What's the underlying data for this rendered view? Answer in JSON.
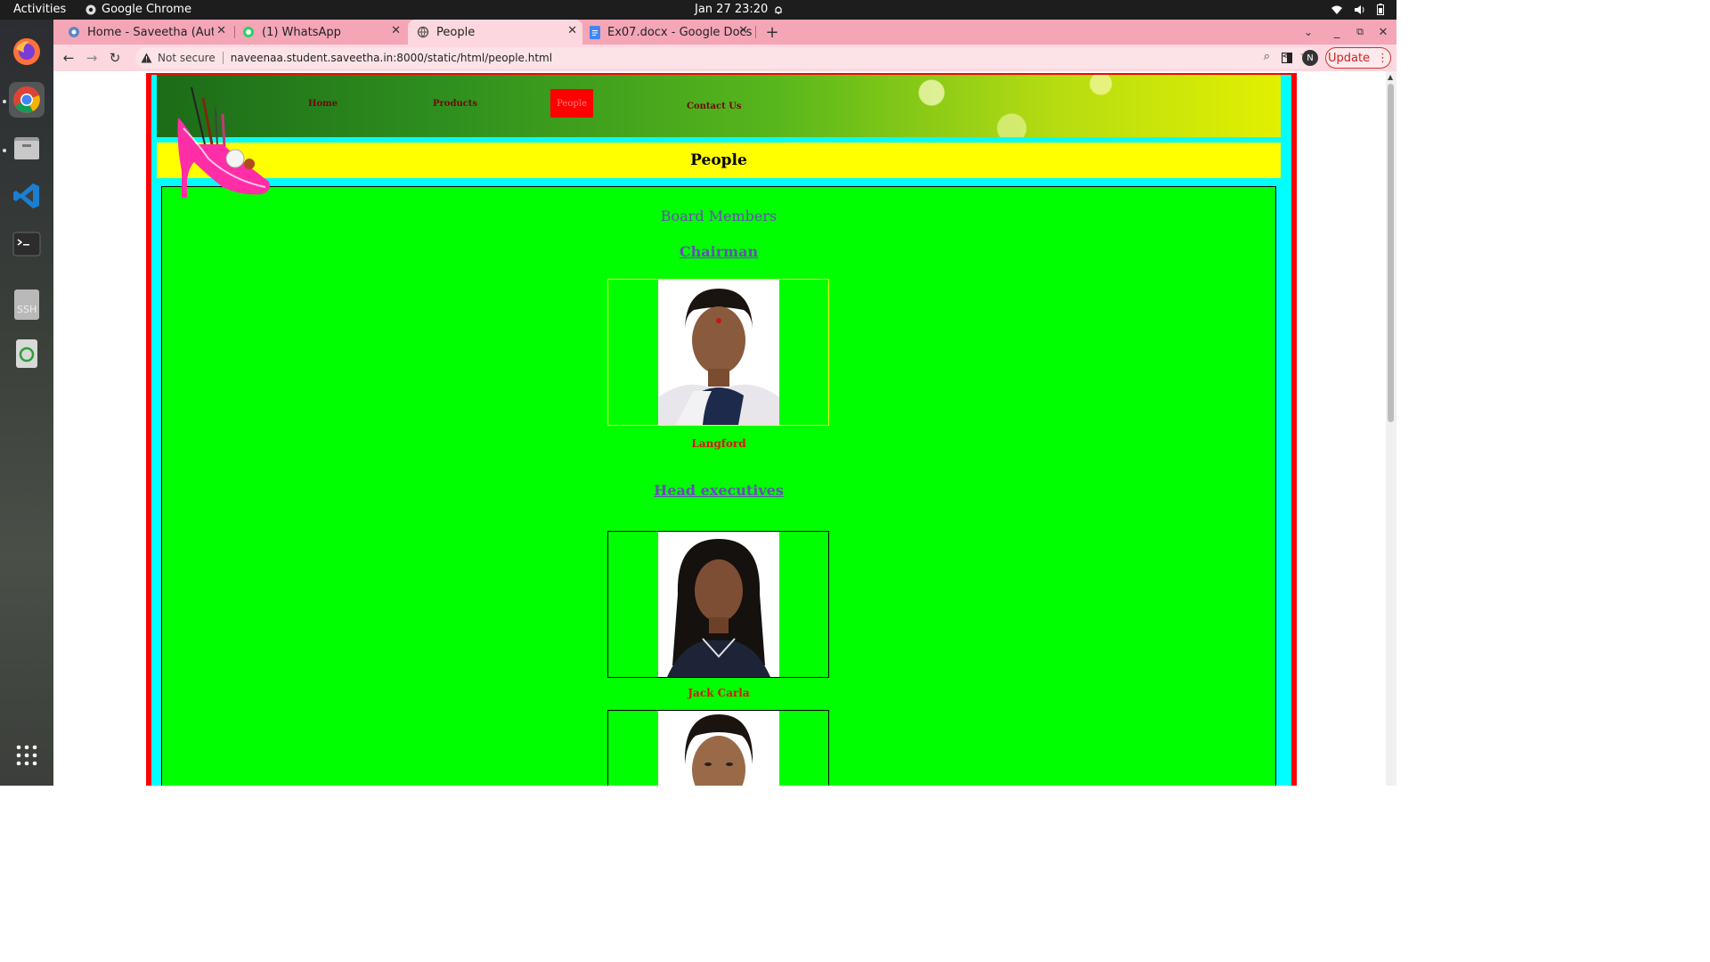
{
  "system": {
    "activities": "Activities",
    "app_name": "Google Chrome",
    "clock": "Jan 27  23:20"
  },
  "browser": {
    "tabs": [
      {
        "label": "Home - Saveetha (Autono",
        "icon": "saveetha-icon"
      },
      {
        "label": "(1) WhatsApp",
        "icon": "whatsapp-icon"
      },
      {
        "label": "People",
        "icon": "globe-icon"
      },
      {
        "label": "Ex07.docx - Google Docs",
        "icon": "docs-icon"
      }
    ],
    "security": "Not secure",
    "url": "naveenaa.student.saveetha.in:8000/static/html/people.html",
    "profile_initial": "N",
    "update_label": "Update"
  },
  "page": {
    "nav": {
      "home": "Home",
      "products": "Products",
      "people": "People",
      "contact": "Contact Us"
    },
    "title": "People",
    "board_heading": "Board Members",
    "chairman_heading": "Chairman",
    "chairman_name": "Langford",
    "executives_heading": "Head executives",
    "executive_1_name": "Jack Carla"
  },
  "colors": {
    "site_border": "#ff0000",
    "site_bg": "#00ffff",
    "title_bg": "#ffff00",
    "content_bg": "#00ff00",
    "name_color": "#e21010",
    "heading_color": "#6a4cb8"
  }
}
